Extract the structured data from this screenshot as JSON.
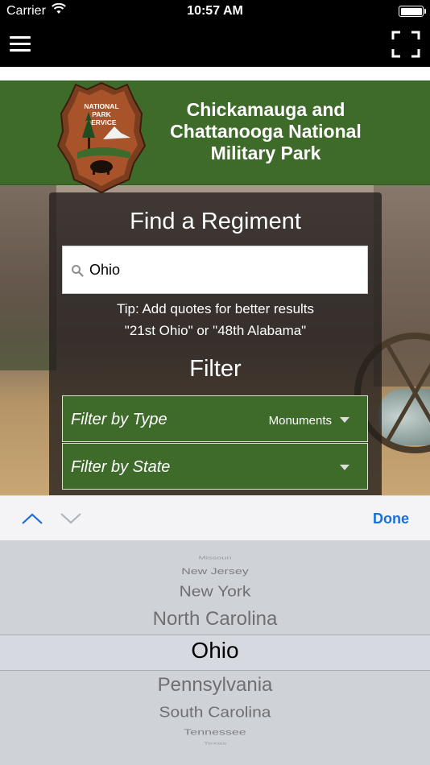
{
  "status_bar": {
    "carrier": "Carrier",
    "time": "10:57 AM",
    "wifi_icon": "wifi-icon",
    "battery_icon": "battery-icon"
  },
  "nav": {
    "menu_icon": "hamburger-menu-icon",
    "expand_icon": "fullscreen-expand-icon"
  },
  "header": {
    "logo_text": [
      "NATIONAL",
      "PARK",
      "SERVICE"
    ],
    "park_title_lines": [
      "Chickamauga and",
      "Chattanooga National",
      "Military Park"
    ],
    "banner_color": "#3f6b2a"
  },
  "search": {
    "title": "Find a Regiment",
    "value": "Ohio",
    "tip_line1": "Tip: Add quotes for better results",
    "tip_line2": "\"21st Ohio\" or \"48th Alabama\""
  },
  "filter": {
    "title": "Filter",
    "type_label": "Filter by Type",
    "type_value": "Monuments",
    "state_label": "Filter by State",
    "state_value": ""
  },
  "toolbar": {
    "done_label": "Done",
    "accent_color": "#1a6fd8"
  },
  "picker": {
    "items": [
      "Missouri",
      "New Jersey",
      "New York",
      "North Carolina",
      "Ohio",
      "Pennsylvania",
      "South Carolina",
      "Tennessee",
      "Texas"
    ],
    "selected": "Ohio"
  }
}
